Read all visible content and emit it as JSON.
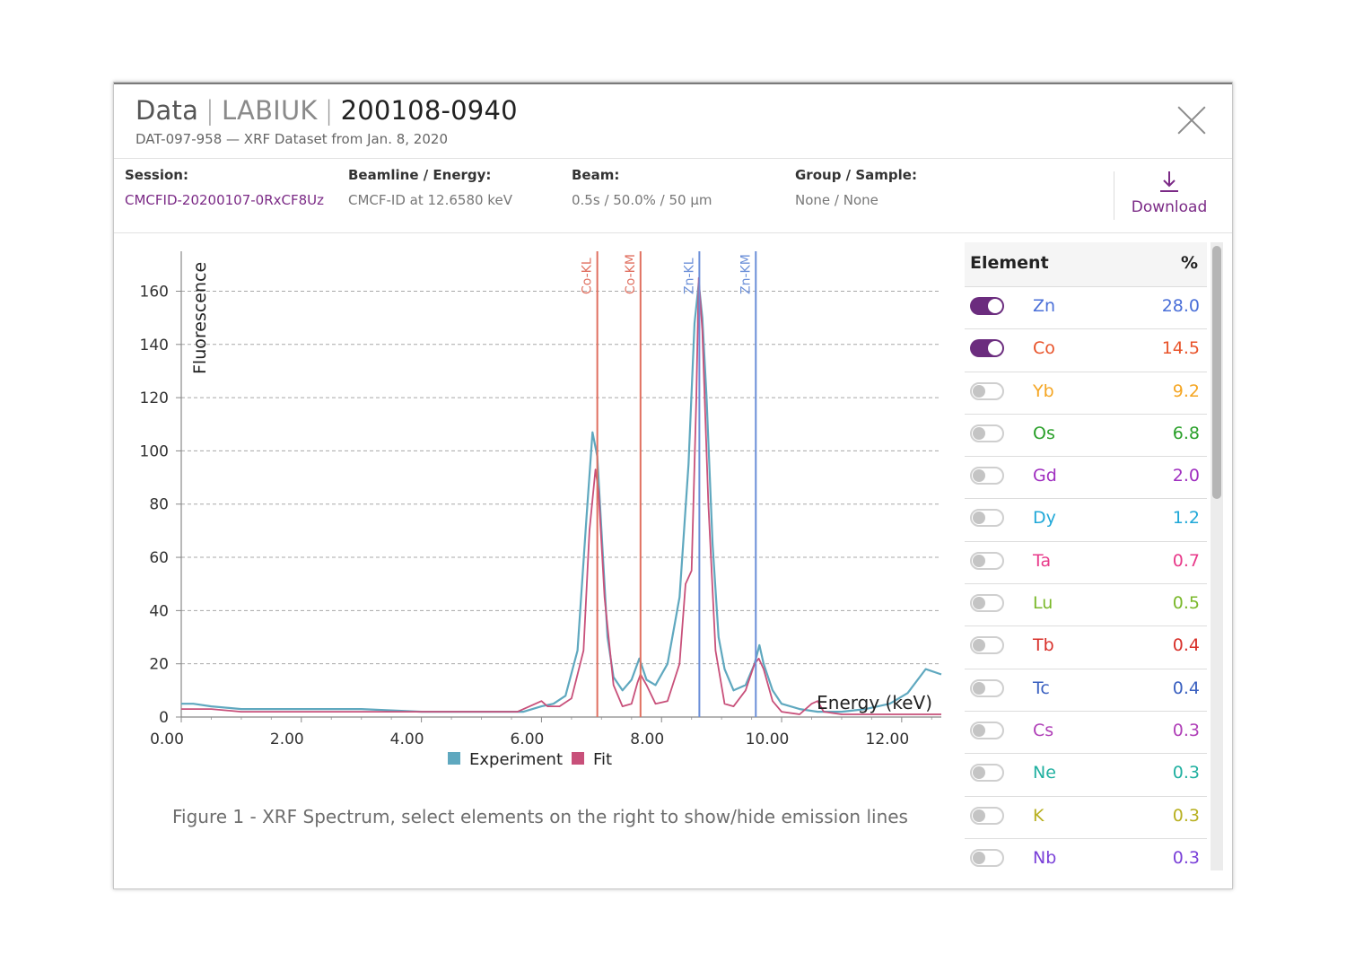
{
  "header": {
    "title_prefix": "Data",
    "title_group": "LABIUK",
    "title_id": "200108-0940",
    "subtitle": "DAT-097-958 — XRF Dataset from Jan. 8, 2020"
  },
  "info": {
    "session_label": "Session:",
    "session_value": "CMCFID-20200107-0RxCF8Uz",
    "beamline_label": "Beamline / Energy:",
    "beamline_value": "CMCF-ID at 12.6580 keV",
    "beam_label": "Beam:",
    "beam_value": "0.5s / 50.0% / 50 µm",
    "group_label": "Group / Sample:",
    "group_value": "None / None",
    "download_label": "Download"
  },
  "caption": "Figure 1 - XRF Spectrum, select elements on the right to show/hide emission lines",
  "table": {
    "col_element": "Element",
    "col_percent": "%",
    "rows": [
      {
        "element": "Zn",
        "percent": "28.0",
        "enabled": true,
        "color": "#4a6fd8"
      },
      {
        "element": "Co",
        "percent": "14.5",
        "enabled": true,
        "color": "#e8532a"
      },
      {
        "element": "Yb",
        "percent": "9.2",
        "enabled": false,
        "color": "#f5a623"
      },
      {
        "element": "Os",
        "percent": "6.8",
        "enabled": false,
        "color": "#2aa02a"
      },
      {
        "element": "Gd",
        "percent": "2.0",
        "enabled": false,
        "color": "#a030c0"
      },
      {
        "element": "Dy",
        "percent": "1.2",
        "enabled": false,
        "color": "#20a8d8"
      },
      {
        "element": "Ta",
        "percent": "0.7",
        "enabled": false,
        "color": "#e83a8a"
      },
      {
        "element": "Lu",
        "percent": "0.5",
        "enabled": false,
        "color": "#7ab82a"
      },
      {
        "element": "Tb",
        "percent": "0.4",
        "enabled": false,
        "color": "#d8302a"
      },
      {
        "element": "Tc",
        "percent": "0.4",
        "enabled": false,
        "color": "#3a60c0"
      },
      {
        "element": "Cs",
        "percent": "0.3",
        "enabled": false,
        "color": "#b040b8"
      },
      {
        "element": "Ne",
        "percent": "0.3",
        "enabled": false,
        "color": "#20b0a0"
      },
      {
        "element": "K",
        "percent": "0.3",
        "enabled": false,
        "color": "#b8b020"
      },
      {
        "element": "Nb",
        "percent": "0.3",
        "enabled": false,
        "color": "#7a40d8"
      }
    ]
  },
  "chart_data": {
    "type": "line",
    "xlabel": "Energy (keV)",
    "ylabel": "Fluorescence",
    "xlim": [
      0,
      12.66
    ],
    "ylim": [
      0,
      175
    ],
    "xticks": [
      "0.00",
      "2.00",
      "4.00",
      "6.00",
      "8.00",
      "10.00",
      "12.00"
    ],
    "yticks": [
      "0",
      "20",
      "40",
      "60",
      "80",
      "100",
      "120",
      "140",
      "160"
    ],
    "grid": true,
    "legend": "bottom",
    "series": [
      {
        "name": "Experiment",
        "color": "#5fa8bf",
        "x": [
          0.0,
          0.2,
          0.5,
          1.0,
          1.5,
          2.0,
          3.0,
          4.0,
          5.0,
          5.7,
          6.0,
          6.2,
          6.4,
          6.6,
          6.75,
          6.85,
          6.93,
          7.0,
          7.1,
          7.2,
          7.35,
          7.5,
          7.63,
          7.75,
          7.9,
          8.1,
          8.3,
          8.45,
          8.55,
          8.62,
          8.68,
          8.75,
          8.85,
          8.95,
          9.05,
          9.2,
          9.4,
          9.55,
          9.63,
          9.7,
          9.85,
          10.0,
          10.3,
          10.6,
          11.0,
          11.4,
          11.8,
          12.1,
          12.4,
          12.66
        ],
        "y": [
          5,
          5,
          4,
          3,
          3,
          3,
          3,
          2,
          2,
          2,
          4,
          5,
          8,
          25,
          75,
          107,
          98,
          70,
          30,
          15,
          10,
          14,
          22,
          14,
          12,
          20,
          45,
          95,
          148,
          163,
          150,
          120,
          65,
          30,
          18,
          10,
          12,
          20,
          27,
          20,
          10,
          5,
          3,
          2,
          2,
          3,
          5,
          9,
          18,
          16
        ]
      },
      {
        "name": "Fit",
        "color": "#c8507a",
        "x": [
          0.0,
          0.5,
          1.0,
          2.0,
          3.0,
          4.0,
          5.0,
          5.6,
          5.9,
          6.0,
          6.1,
          6.3,
          6.5,
          6.7,
          6.8,
          6.9,
          6.95,
          7.05,
          7.2,
          7.35,
          7.5,
          7.6,
          7.65,
          7.75,
          7.9,
          8.1,
          8.3,
          8.4,
          8.5,
          8.58,
          8.62,
          8.68,
          8.78,
          8.9,
          9.05,
          9.2,
          9.4,
          9.55,
          9.62,
          9.7,
          9.85,
          10.0,
          10.3,
          10.5,
          10.6,
          10.7,
          11.0,
          11.5,
          12.0,
          12.66
        ],
        "y": [
          3,
          3,
          2,
          2,
          2,
          2,
          2,
          2,
          5,
          6,
          4,
          4,
          7,
          25,
          70,
          93,
          85,
          45,
          12,
          4,
          5,
          13,
          16,
          12,
          5,
          6,
          20,
          50,
          55,
          120,
          165,
          145,
          80,
          25,
          5,
          4,
          10,
          20,
          22,
          18,
          6,
          2,
          1,
          5,
          6,
          2,
          1,
          1,
          1,
          1
        ]
      }
    ],
    "emission_lines": [
      {
        "label": "Co-KL",
        "energy": 6.93,
        "color": "#e07060"
      },
      {
        "label": "Co-KM",
        "energy": 7.65,
        "color": "#e07060"
      },
      {
        "label": "Zn-KL",
        "energy": 8.63,
        "color": "#6b8fd8"
      },
      {
        "label": "Zn-KM",
        "energy": 9.57,
        "color": "#6b8fd8"
      }
    ]
  }
}
